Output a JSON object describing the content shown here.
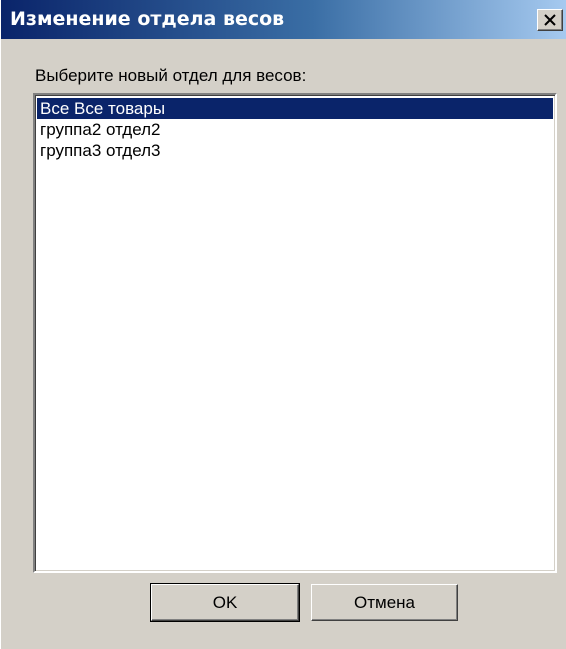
{
  "window": {
    "title": "Изменение отдела весов"
  },
  "dialog": {
    "prompt": "Выберите новый отдел для весов:",
    "items": [
      {
        "label": "Все Все товары",
        "selected": true
      },
      {
        "label": "группа2 отдел2",
        "selected": false
      },
      {
        "label": "группа3 отдел3",
        "selected": false
      }
    ],
    "ok_label": "OK",
    "cancel_label": "Отмена"
  },
  "icons": {
    "close": "close-icon"
  },
  "colors": {
    "title_bar_start": "#0a246a",
    "title_bar_end": "#a6caf0",
    "selection": "#0a246a",
    "dialog_face": "#d4d0c8"
  }
}
